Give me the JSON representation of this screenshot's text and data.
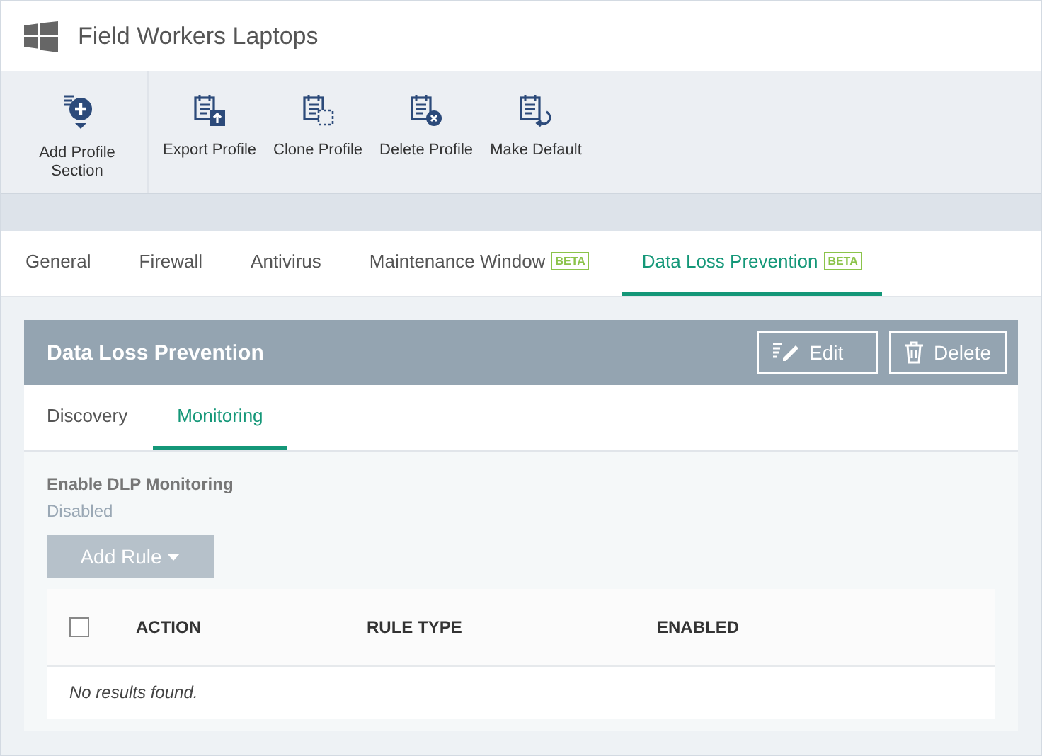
{
  "window": {
    "title": "Field Workers Laptops"
  },
  "toolbar": [
    {
      "label": "Add Profile Section",
      "kind": "add"
    },
    {
      "label": "Export Profile",
      "kind": "export"
    },
    {
      "label": "Clone Profile",
      "kind": "clone"
    },
    {
      "label": "Delete Profile",
      "kind": "delete"
    },
    {
      "label": "Make Default",
      "kind": "default"
    }
  ],
  "tabs": [
    {
      "label": "General",
      "selected": false
    },
    {
      "label": "Firewall",
      "selected": false
    },
    {
      "label": "Antivirus",
      "selected": false
    },
    {
      "label": "Maintenance Window",
      "badge": "BETA",
      "selected": false
    },
    {
      "label": "Data Loss Prevention",
      "badge": "BETA",
      "selected": true
    }
  ],
  "panel": {
    "title": "Data Loss Prevention",
    "buttons": [
      {
        "label": "Edit",
        "kind": "edit"
      },
      {
        "label": "Delete",
        "kind": "delete"
      }
    ],
    "subtabs": [
      {
        "label": "Discovery",
        "selected": false
      },
      {
        "label": "Monitoring",
        "selected": true
      }
    ],
    "setting": {
      "label": "Enable DLP Monitoring",
      "value": "Disabled"
    },
    "add_rule": {
      "label": "Add Rule",
      "disabled": true
    },
    "table": {
      "select_all": {
        "checked": false
      },
      "columns": [
        "ACTION",
        "RULE TYPE",
        "ENABLED"
      ],
      "empty": "No results found."
    }
  }
}
